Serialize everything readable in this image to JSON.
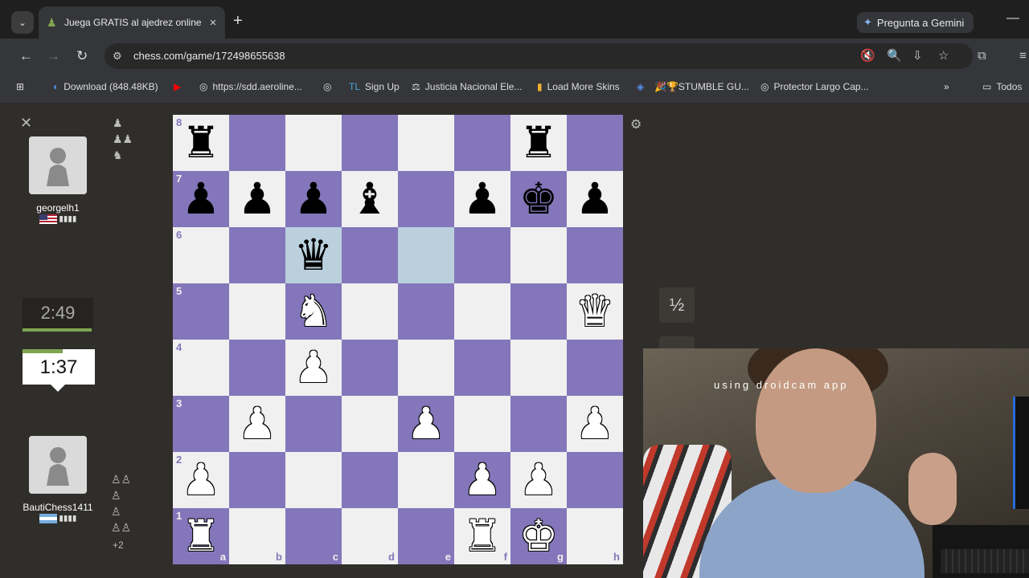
{
  "browser": {
    "tab_title": "Juega GRATIS al ajedrez online -",
    "tab_close": "×",
    "new_tab": "+",
    "gemini_label": "Pregunta a Gemini",
    "url": "chess.com/game/172498655638",
    "bookmarks": [
      {
        "label": "Download (848.48KB)",
        "icon": "download-icon"
      },
      {
        "label": "",
        "icon": "youtube-icon"
      },
      {
        "label": "https://sdd.aeroline...",
        "icon": "globe-icon"
      },
      {
        "label": "",
        "icon": "globe-icon"
      },
      {
        "label": "Sign Up",
        "icon": "tl-icon"
      },
      {
        "label": "Justicia Nacional Ele...",
        "icon": "justice-icon"
      },
      {
        "label": "Load More Skins",
        "icon": "chart-icon"
      },
      {
        "label": "",
        "icon": "roblox-icon"
      },
      {
        "label": "🎉🏆STUMBLE GU...",
        "icon": "stumble-icon"
      },
      {
        "label": "Protector Largo Cap...",
        "icon": "globe-icon"
      },
      {
        "label": "Todos",
        "icon": "folder-icon"
      }
    ],
    "more_bookmarks": "»"
  },
  "game": {
    "top_player": {
      "name": "georgelh1",
      "country": "US",
      "captured": "♟ ♟♟ ♞"
    },
    "bottom_player": {
      "name": "BautiChess1411",
      "country": "AR",
      "captured": "♟♟ ♟ ♙ ♙♙",
      "extra": "+2"
    },
    "top_clock": "2:49",
    "bottom_clock": "1:37",
    "draw_button": "½",
    "webcam_caption": "using droidcam app",
    "board": {
      "ranks": [
        "8",
        "7",
        "6",
        "5",
        "4",
        "3",
        "2",
        "1"
      ],
      "files": [
        "a",
        "b",
        "c",
        "d",
        "e",
        "f",
        "g",
        "h"
      ],
      "position": [
        [
          "bR",
          "",
          "",
          "",
          "",
          "",
          "bR",
          ""
        ],
        [
          "bP",
          "bP",
          "bP",
          "bB",
          "",
          "bP",
          "bK",
          "bP"
        ],
        [
          "",
          "",
          "bQ",
          "",
          "",
          "",
          "",
          ""
        ],
        [
          "",
          "",
          "wN",
          "",
          "",
          "",
          "",
          "wQ"
        ],
        [
          "",
          "",
          "wP",
          "",
          "",
          "",
          "",
          ""
        ],
        [
          "",
          "wP",
          "",
          "",
          "wP",
          "",
          "",
          "wP"
        ],
        [
          "wP",
          "",
          "",
          "",
          "",
          "wP",
          "wP",
          ""
        ],
        [
          "wR",
          "",
          "",
          "",
          "",
          "wR",
          "wK",
          ""
        ]
      ],
      "highlighted_squares": [
        "c6",
        "e6"
      ]
    }
  }
}
